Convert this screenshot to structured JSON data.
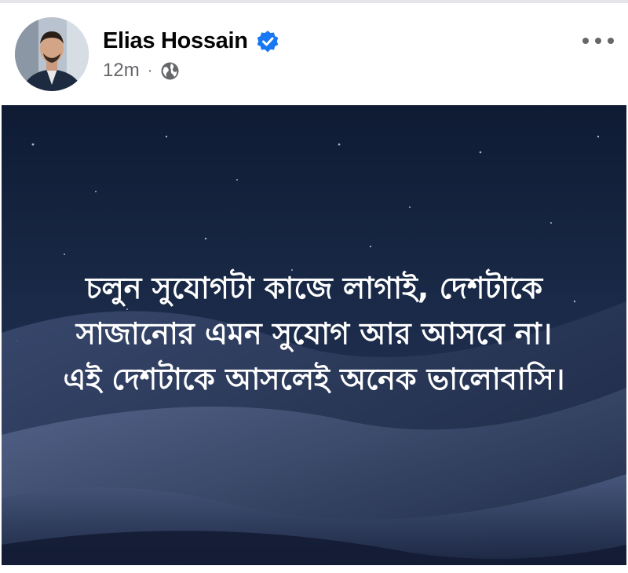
{
  "post": {
    "author": "Elias Hossain",
    "verified": true,
    "time": "12m",
    "separator": "·",
    "audience_icon": "globe-icon",
    "more_icon": "more-options-icon"
  },
  "image": {
    "text_lines": [
      "চলুন সুযোগটা কাজে লাগাই, দেশটাকে",
      "সাজানোর এমন সুযোগ আর আসবে না।",
      "এই দেশটাকে আসলেই অনেক ভালোবাসি।"
    ]
  },
  "colors": {
    "verified_blue": "#1877f2",
    "secondary_text": "#65676b",
    "primary_text": "#050505"
  }
}
